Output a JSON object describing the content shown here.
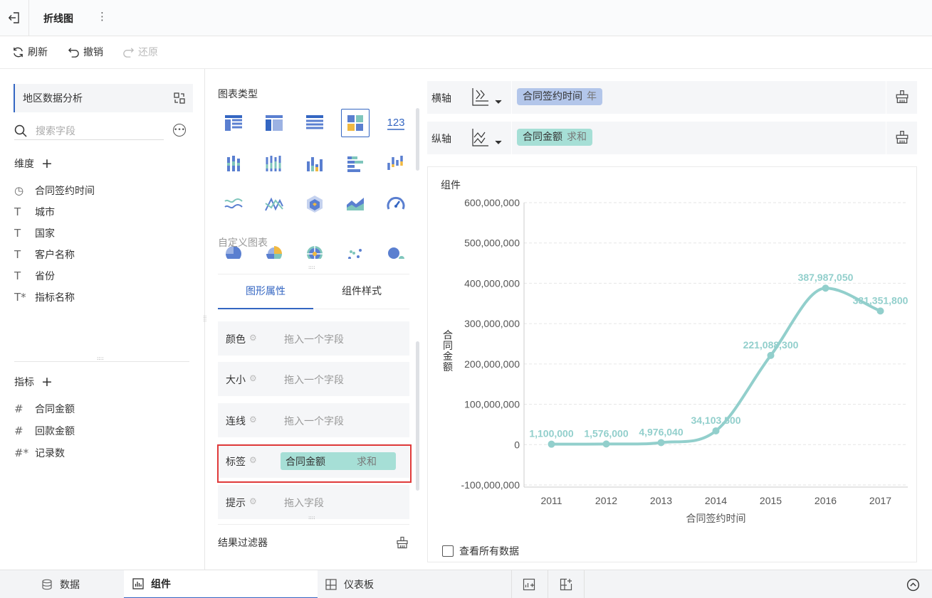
{
  "topbar": {
    "title": "折线图",
    "more": "⋮"
  },
  "toolbar": {
    "refresh": "刷新",
    "undo": "撤销",
    "redo": "还原"
  },
  "left": {
    "dataset": "地区数据分析",
    "search_placeholder": "搜索字段",
    "dimensions_title": "维度",
    "dimensions": [
      {
        "icon": "clock-icon",
        "label": "合同签约时间"
      },
      {
        "icon": "text-field-icon",
        "label": "城市"
      },
      {
        "icon": "text-field-icon",
        "label": "国家"
      },
      {
        "icon": "text-field-icon",
        "label": "客户名称"
      },
      {
        "icon": "text-field-icon",
        "label": "省份"
      },
      {
        "icon": "calc-text-field-icon",
        "label": "指标名称"
      }
    ],
    "metrics_title": "指标",
    "metrics": [
      {
        "icon": "number-field-icon",
        "label": "合同金额"
      },
      {
        "icon": "number-field-icon",
        "label": "回款金额"
      },
      {
        "icon": "calc-number-field-icon",
        "label": "记录数"
      }
    ]
  },
  "mid": {
    "chart_type_label": "图表类型",
    "chart_types": [
      "table-icon",
      "cross-table-icon",
      "detail-table-icon",
      "auto-chart-icon",
      "kpi-number-icon",
      "grouped-column-icon",
      "stacked-column-icon",
      "column-chart-icon",
      "bar-chart-icon",
      "waterfall-icon",
      "line-chart-icon",
      "stock-line-icon",
      "radar-icon",
      "area-chart-icon",
      "gauge-icon",
      "pie-chart-icon",
      "donut-chart-icon",
      "rose-chart-icon",
      "scatter-icon",
      "bubble-icon"
    ],
    "kpi_text": "123",
    "custom_chart": "自定义图表",
    "tab_graph": "图形属性",
    "tab_style": "组件样式",
    "props": [
      {
        "name": "颜色",
        "hint": "拖入一个字段"
      },
      {
        "name": "大小",
        "hint": "拖入一个字段"
      },
      {
        "name": "连线",
        "hint": "拖入一个字段"
      },
      {
        "name": "标签",
        "pill_field": "合同金额",
        "pill_agg": "求和"
      },
      {
        "name": "提示",
        "hint": "拖入字段"
      }
    ],
    "filter_label": "结果过滤器"
  },
  "right": {
    "x_axis_label": "横轴",
    "x_field": "合同签约时间",
    "x_sub": "年",
    "y_axis_label": "纵轴",
    "y_field": "合同金额",
    "y_sub": "求和",
    "component_label": "组件",
    "show_all": "查看所有数据",
    "colors": {
      "x_pill": "#b3c6ea",
      "y_pill": "#a6dfd6",
      "line": "#92cfcc"
    }
  },
  "chart_data": {
    "type": "line",
    "x": [
      "2011",
      "2012",
      "2013",
      "2014",
      "2015",
      "2016",
      "2017"
    ],
    "series": [
      {
        "values": [
          1100000,
          1576000,
          4976040,
          34103500,
          221088300,
          387987050,
          331351800
        ]
      }
    ],
    "data_labels": [
      "1,100,000",
      "1,576,000",
      "4,976,040",
      "34,103,500",
      "221,088,300",
      "387,987,050",
      "331,351,800"
    ],
    "yticks": [
      -100000000,
      0,
      100000000,
      200000000,
      300000000,
      400000000,
      500000000,
      600000000
    ],
    "ytick_labels": [
      "-100,000,000",
      "0",
      "100,000,000",
      "200,000,000",
      "300,000,000",
      "400,000,000",
      "500,000,000",
      "600,000,000"
    ],
    "ylim": [
      -100000000,
      600000000
    ],
    "xlabel": "合同签约时间",
    "ylabel": "合同金额",
    "grid": true,
    "smooth": true
  },
  "bottom": {
    "data": "数据",
    "component": "组件",
    "dashboard": "仪表板"
  }
}
